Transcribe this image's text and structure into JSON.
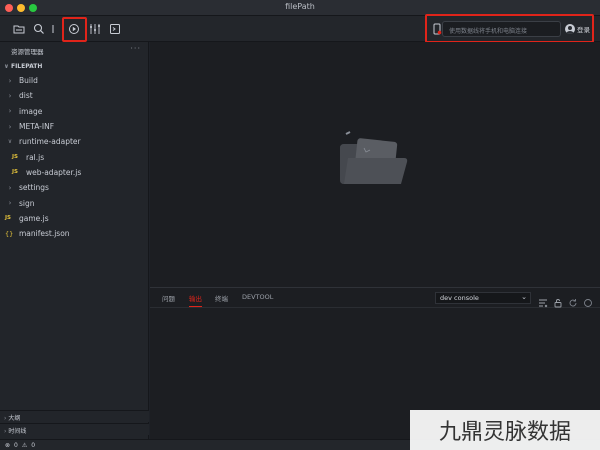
{
  "window": {
    "title": "filePath"
  },
  "toolbar": {
    "preview_text": "使用数据线将手机和电脑连接",
    "login_label": "登录"
  },
  "sidebar": {
    "header": "资源管理器",
    "more": "···",
    "root": "FILEPATH",
    "items": [
      {
        "label": "Build",
        "kind": "folder"
      },
      {
        "label": "dist",
        "kind": "folder"
      },
      {
        "label": "image",
        "kind": "folder"
      },
      {
        "label": "META-INF",
        "kind": "folder"
      },
      {
        "label": "runtime-adapter",
        "kind": "folder-open"
      },
      {
        "label": "ral.js",
        "kind": "js"
      },
      {
        "label": "web-adapter.js",
        "kind": "js"
      },
      {
        "label": "settings",
        "kind": "folder"
      },
      {
        "label": "sign",
        "kind": "folder"
      },
      {
        "label": "game.js",
        "kind": "js"
      },
      {
        "label": "manifest.json",
        "kind": "json"
      }
    ],
    "outline": "大纲",
    "timeline": "时间线"
  },
  "panel": {
    "tabs": [
      "问题",
      "输出",
      "终端",
      "DEVTOOL"
    ],
    "active_tab": "输出",
    "console_option": "dev console"
  },
  "status": {
    "errors": "0",
    "warnings": "0"
  },
  "watermark": "九鼎灵脉数据",
  "colors": {
    "highlight": "#e0241a",
    "accent_js": "#e3c23a"
  }
}
